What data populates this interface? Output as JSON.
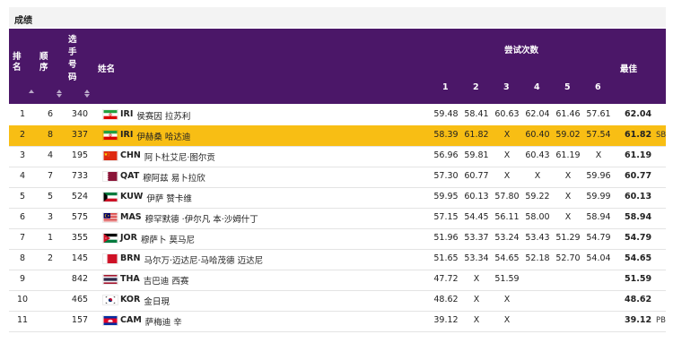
{
  "section_title": "成绩",
  "headers": {
    "rank": "排名",
    "order": "顺序",
    "bib": "选手号码",
    "name": "姓名",
    "attempts": "尝试次数",
    "attempt_numbers": [
      "1",
      "2",
      "3",
      "4",
      "5",
      "6"
    ],
    "best": "最佳"
  },
  "rows": [
    {
      "rank": "1",
      "order": "6",
      "bib": "340",
      "country": "IRI",
      "name": "侯赛因 拉苏利",
      "marks": [
        "59.48",
        "58.41",
        "60.63",
        "62.04",
        "61.46",
        "57.61"
      ],
      "best": "62.04",
      "note": "",
      "flag": "iri"
    },
    {
      "rank": "2",
      "order": "8",
      "bib": "337",
      "country": "IRI",
      "name": "伊赫桑 哈达迪",
      "marks": [
        "58.39",
        "61.82",
        "X",
        "60.40",
        "59.02",
        "57.54"
      ],
      "best": "61.82",
      "note": "SB",
      "flag": "iri"
    },
    {
      "rank": "3",
      "order": "4",
      "bib": "195",
      "country": "CHN",
      "name": "阿卜杜艾尼·图尔贡",
      "marks": [
        "56.96",
        "59.81",
        "X",
        "60.43",
        "61.19",
        "X"
      ],
      "best": "61.19",
      "note": "",
      "flag": "chn"
    },
    {
      "rank": "4",
      "order": "7",
      "bib": "733",
      "country": "QAT",
      "name": "穆阿兹 易卜拉欣",
      "marks": [
        "57.30",
        "60.77",
        "X",
        "X",
        "X",
        "59.96"
      ],
      "best": "60.77",
      "note": "",
      "flag": "qat"
    },
    {
      "rank": "5",
      "order": "5",
      "bib": "524",
      "country": "KUW",
      "name": "伊萨 赞卡维",
      "marks": [
        "59.95",
        "60.13",
        "57.80",
        "59.22",
        "X",
        "59.99"
      ],
      "best": "60.13",
      "note": "",
      "flag": "kuw"
    },
    {
      "rank": "6",
      "order": "3",
      "bib": "575",
      "country": "MAS",
      "name": "穆罕默德 ·伊尔凡 本·沙姆什丁",
      "marks": [
        "57.15",
        "54.45",
        "56.11",
        "58.00",
        "X",
        "58.94"
      ],
      "best": "58.94",
      "note": "",
      "flag": "mas"
    },
    {
      "rank": "7",
      "order": "1",
      "bib": "355",
      "country": "JOR",
      "name": "穆萨卜 莫马尼",
      "marks": [
        "51.96",
        "53.37",
        "53.24",
        "53.43",
        "51.29",
        "54.79"
      ],
      "best": "54.79",
      "note": "",
      "flag": "jor"
    },
    {
      "rank": "8",
      "order": "2",
      "bib": "145",
      "country": "BRN",
      "name": "马尔万·迈达尼·马哈茂德 迈达尼",
      "marks": [
        "51.65",
        "53.34",
        "54.65",
        "52.18",
        "52.70",
        "54.04"
      ],
      "best": "54.65",
      "note": "",
      "flag": "brn"
    },
    {
      "rank": "9",
      "order": "",
      "bib": "842",
      "country": "THA",
      "name": "吉巴迪 西赛",
      "marks": [
        "47.72",
        "X",
        "51.59",
        "",
        "",
        ""
      ],
      "best": "51.59",
      "note": "",
      "flag": "tha"
    },
    {
      "rank": "10",
      "order": "",
      "bib": "465",
      "country": "KOR",
      "name": "金日現",
      "marks": [
        "48.62",
        "X",
        "X",
        "",
        "",
        ""
      ],
      "best": "48.62",
      "note": "",
      "flag": "kor"
    },
    {
      "rank": "11",
      "order": "",
      "bib": "157",
      "country": "CAM",
      "name": "萨梅迪 辛",
      "marks": [
        "39.12",
        "X",
        "X",
        "",
        "",
        ""
      ],
      "best": "39.12",
      "note": "PB",
      "flag": "cam"
    }
  ],
  "colors": {
    "header_bg": "#4b1768",
    "highlight_row": "#f8be14"
  }
}
